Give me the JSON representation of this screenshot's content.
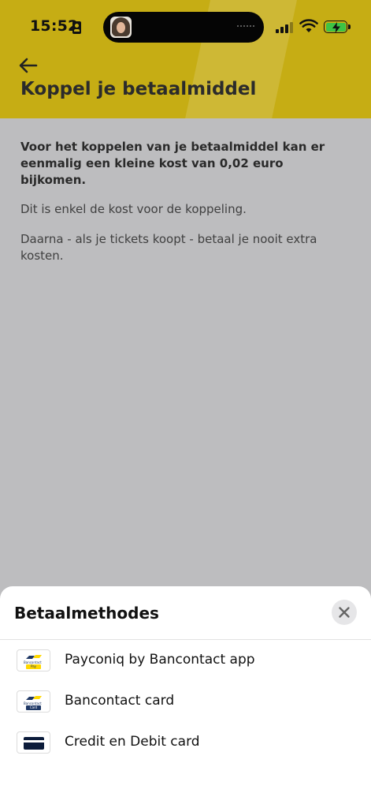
{
  "status_bar": {
    "time": "15:52"
  },
  "header": {
    "title": "Koppel je betaalmiddel",
    "background": "#c6ad14"
  },
  "content": {
    "lead": "Voor het koppelen van je betaalmiddel kan er eenmalig een kleine kost van 0,02 euro bijkomen.",
    "paragraphs": [
      "Dit is enkel de kost voor de koppeling.",
      "Daarna - als je tickets koopt - betaal je nooit extra kosten."
    ]
  },
  "sheet": {
    "title": "Betaalmethodes",
    "methods": [
      {
        "label": "Payconiq by Bancontact app",
        "icon": "payconiq-bancontact-icon",
        "tag": "Pay"
      },
      {
        "label": "Bancontact card",
        "icon": "bancontact-card-icon",
        "tag": "Card"
      },
      {
        "label": "Credit en Debit card",
        "icon": "credit-card-icon"
      }
    ]
  },
  "logos": {
    "bancontact_text": "Bancontact"
  }
}
